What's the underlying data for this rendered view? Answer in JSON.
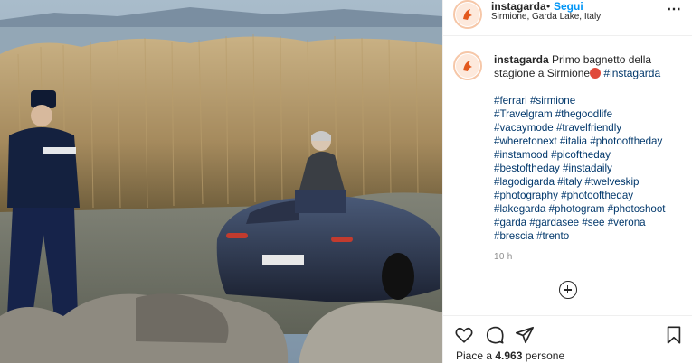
{
  "post": {
    "username": "instagarda",
    "separator": "•",
    "follow_label": "Segui",
    "location": "Sirmione, Garda Lake, Italy",
    "more_icon": "⋯"
  },
  "caption": {
    "username": "instagarda",
    "text": "Primo bagnetto della stagione a Sirmione",
    "emoji": "angry-face-emoji",
    "tag": "#instagarda"
  },
  "hashtags": [
    "#ferrari #sirmione",
    "#Travelgram #thegoodlife",
    "#vacaymode #travelfriendly",
    "#wheretonext #italia #photooftheday",
    "#instamood #picoftheday",
    "#bestoftheday #instadaily",
    "#lagodigarda #italy #twelveskip",
    "#photography #photooftheday",
    "#lakegarda #photogram #photoshoot",
    "#garda #gardasee #see #verona",
    "#brescia #trento"
  ],
  "time_ago": "10 h",
  "likes": {
    "prefix": "Piace a",
    "count": "4.963",
    "suffix": "persone"
  },
  "colors": {
    "link_blue": "#0095f6",
    "hashtag": "#00376b",
    "muted": "#8e8e8e"
  }
}
